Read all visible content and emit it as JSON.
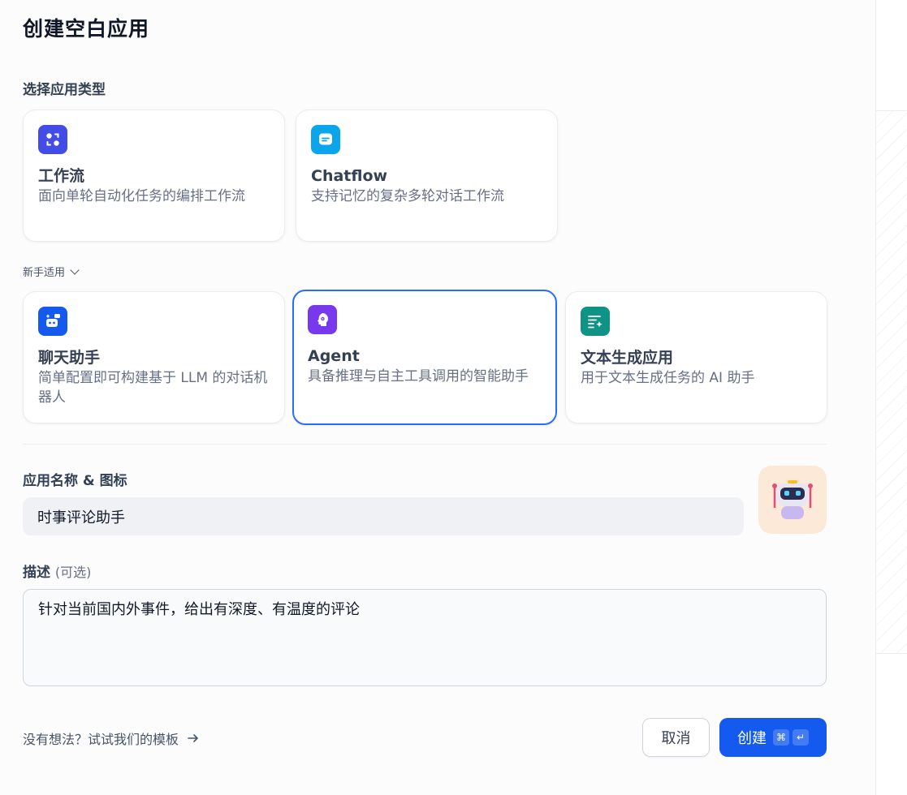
{
  "dialog": {
    "title": "创建空白应用"
  },
  "app_type": {
    "label": "选择应用类型",
    "primary": [
      {
        "name": "工作流",
        "desc": "面向单轮自动化任务的编排工作流",
        "icon": "workflow-icon",
        "color": "#444ce7"
      },
      {
        "name": "Chatflow",
        "desc": "支持记忆的复杂多轮对话工作流",
        "icon": "chatflow-icon",
        "color": "#0ba5ec"
      }
    ],
    "beginner_toggle": "新手适用",
    "beginner": [
      {
        "name": "聊天助手",
        "desc": "简单配置即可构建基于 LLM 的对话机器人",
        "icon": "chat-assistant-icon",
        "color": "#155aef"
      },
      {
        "name": "Agent",
        "desc": "具备推理与自主工具调用的智能助手",
        "icon": "agent-icon",
        "color": "#7839ee",
        "selected": true
      },
      {
        "name": "文本生成应用",
        "desc": "用于文本生成任务的 AI 助手",
        "icon": "text-generation-icon",
        "color": "#0e9384"
      }
    ]
  },
  "name_icon": {
    "label": "应用名称 & 图标",
    "value": "时事评论助手",
    "avatar_icon": "robot-icon",
    "avatar_bg": "#fde9d7"
  },
  "description": {
    "label": "描述",
    "optional": "(可选)",
    "value": "针对当前国内外事件，给出有深度、有温度的评论"
  },
  "footer": {
    "template_link": "没有想法？试试我们的模板",
    "cancel": "取消",
    "create": "创建",
    "shortcut_cmd": "⌘",
    "shortcut_enter": "↵"
  },
  "colors": {
    "accent": "#155aef",
    "selected_border": "#296dff"
  }
}
